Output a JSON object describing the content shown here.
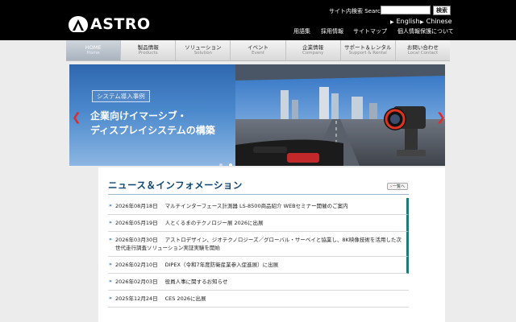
{
  "header": {
    "logo_text": "ASTRO",
    "search_label": "サイト内検索 Search",
    "search_button": "検索",
    "lang_english": "English",
    "lang_chinese": "Chinese",
    "top_links": [
      "用語集",
      "採用情報",
      "サイトマップ",
      "個人情報保護について"
    ]
  },
  "nav": [
    {
      "jp": "HOME",
      "en": "Home"
    },
    {
      "jp": "製品情報",
      "en": "Products"
    },
    {
      "jp": "ソリューション",
      "en": "Solution"
    },
    {
      "jp": "イベント",
      "en": "Event"
    },
    {
      "jp": "企業情報",
      "en": "Company"
    },
    {
      "jp": "サポート＆レンタル",
      "en": "Support & Rental"
    },
    {
      "jp": "お問い合わせ",
      "en": "Local Contact"
    }
  ],
  "banner": {
    "tag": "システム導入事例",
    "title_line1": "企業向けイマーシブ・",
    "title_line2": "ディスプレイシステムの構築"
  },
  "news": {
    "title": "ニュース＆インフォメーション",
    "list_button": "一覧へ",
    "items": [
      {
        "date": "2026年08月18日",
        "text": "マルチインターフェース計測器 LS-8500商品紹介 WEBセミナー開催のご案内"
      },
      {
        "date": "2026年05月19日",
        "text": "人とくるまのテクノロジー展 2026に出展"
      },
      {
        "date": "2026年03月30日",
        "text": "アストロデザイン、ジオテクノロジーズ／グローバル・サーベイと協業し、8K映像技術を活用した次世代走行調査ソリューション実証実験を開始"
      },
      {
        "date": "2026年02月10日",
        "text": "DIPEX（令和7年度防衛産業参入促進展）に出展"
      },
      {
        "date": "2026年02月03日",
        "text": "役員人事に関するお知らせ"
      },
      {
        "date": "2025年12月24日",
        "text": "CES 2026に出展"
      }
    ]
  },
  "colors": {
    "header_bg": "#000000",
    "accent": "#0c4573",
    "banner": "#3b74b8",
    "arrow": "#e02a2a"
  }
}
